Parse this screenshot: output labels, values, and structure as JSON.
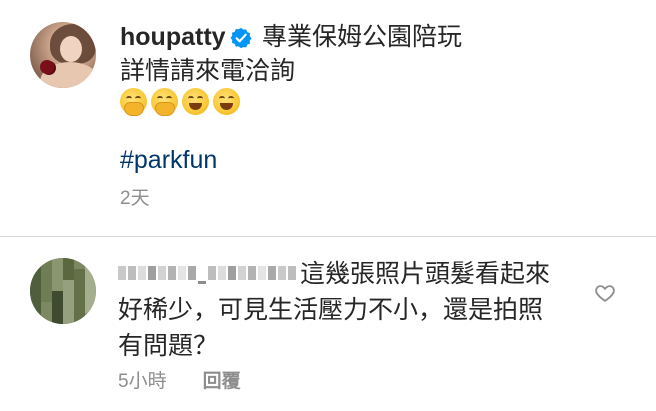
{
  "post": {
    "username": "houpatty",
    "caption_first": "專業保姆公園陪玩",
    "caption_second": "詳情請來電洽詢",
    "emojis": [
      "hand-over-mouth-emoji",
      "hand-over-mouth-emoji",
      "grinning-emoji",
      "grinning-emoji"
    ],
    "hashtag": "#parkfun",
    "time": "2天"
  },
  "comment": {
    "lines": [
      "這幾張照片頭髮看起來",
      "好稀少，可見生活壓力不小，還是拍照",
      "有問題？"
    ],
    "time": "5小時",
    "reply_label": "回覆"
  },
  "colors": {
    "text": "#262626",
    "secondary": "#8e8e8e",
    "hashtag": "#00376b",
    "verified": "#0095f6",
    "divider": "#dbdbdb"
  }
}
